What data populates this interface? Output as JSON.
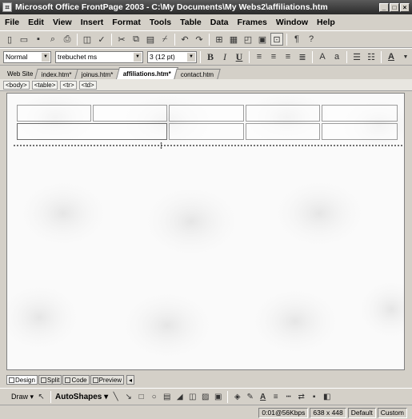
{
  "window": {
    "title": "Microsoft Office FrontPage 2003 - C:\\My Documents\\My Webs2\\affiliations.htm",
    "minimize": "_",
    "maximize": "□",
    "close": "×"
  },
  "menu": [
    "File",
    "Edit",
    "View",
    "Insert",
    "Format",
    "Tools",
    "Table",
    "Data",
    "Frames",
    "Window",
    "Help"
  ],
  "formatting": {
    "style": "Normal",
    "font": "trebuchet ms",
    "size": "3 (12 pt)"
  },
  "tabs": [
    {
      "label": "Web Site"
    },
    {
      "label": "index.htm*"
    },
    {
      "label": "joinus.htm*"
    },
    {
      "label": "affiliations.htm*"
    },
    {
      "label": "contact.htm"
    }
  ],
  "tags": [
    "<body>",
    "<table>",
    "<tr>",
    "<td>"
  ],
  "view_tabs": [
    "Design",
    "Split",
    "Code",
    "Preview"
  ],
  "draw_toolbar": {
    "draw_label": "Draw ▾",
    "autoshapes_label": "AutoShapes ▾"
  },
  "status": {
    "download": "0:01@56Kbps",
    "size": "638 x 448",
    "mode": "Default",
    "custom": "Custom"
  }
}
